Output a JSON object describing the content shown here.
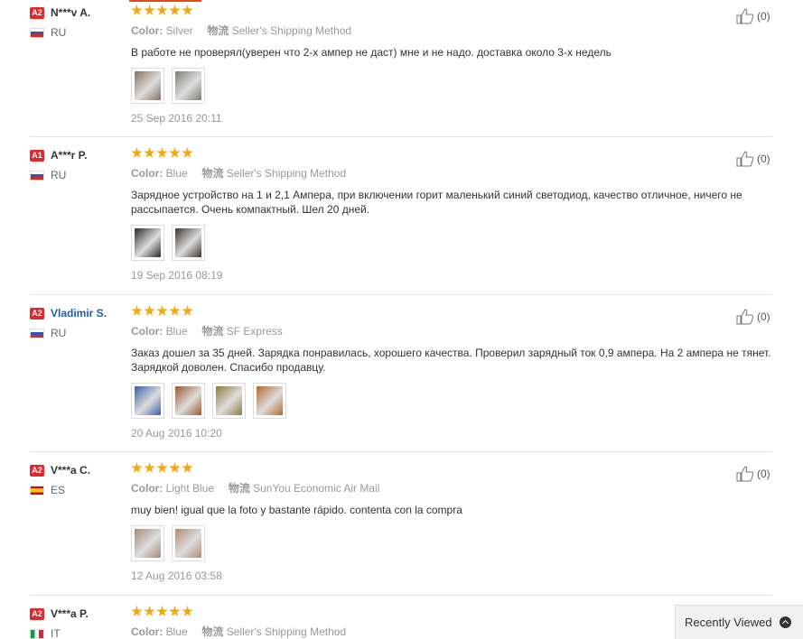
{
  "feedback": [
    {
      "level": "A2",
      "name": "N***v A.",
      "name_link": false,
      "country": "RU",
      "flag": "ru",
      "rating": 5,
      "color_label": "Color:",
      "color_value": "Silver",
      "ship_label": "物流",
      "ship_value": "Seller's Shipping Method",
      "text": "В работе не проверял(уверен что 2-х ампер не даст) мне и не надо. доставка около 3-х недель",
      "thumbs": [
        "#8a6f5e",
        "#7d7d78"
      ],
      "date": "25 Sep 2016 20:11",
      "helpful": "(0)"
    },
    {
      "level": "A1",
      "name": "A***r P.",
      "name_link": false,
      "country": "RU",
      "flag": "ru",
      "rating": 5,
      "color_label": "Color:",
      "color_value": "Blue",
      "ship_label": "物流",
      "ship_value": "Seller's Shipping Method",
      "text": "Зарядное устройство на 1 и 2,1 Ампера, при включении горит маленький синий светодиод, качество отличное, ничего не рассыпается. Очень компактный. Шел 20 дней.",
      "thumbs": [
        "#2a2a2a",
        "#3a3330"
      ],
      "date": "19 Sep 2016 08:19",
      "helpful": "(0)"
    },
    {
      "level": "A2",
      "name": "Vladimir S.",
      "name_link": true,
      "country": "RU",
      "flag": "ru",
      "rating": 5,
      "color_label": "Color:",
      "color_value": "Blue",
      "ship_label": "物流",
      "ship_value": "SF Express",
      "text": "Заказ дошел за 35 дней. Зарядка понравилась, хорошего качества. Проверил зарядный ток 0,9 ампера. На 2 ампера не тянет. Зарядкой доволен. Спасибо продавцу.",
      "thumbs": [
        "#3b5fa8",
        "#9a5a2e",
        "#8f7a3a",
        "#b3692e"
      ],
      "date": "20 Aug 2016 10:20",
      "helpful": "(0)"
    },
    {
      "level": "A2",
      "name": "V***a C.",
      "name_link": false,
      "country": "ES",
      "flag": "es",
      "rating": 5,
      "color_label": "Color:",
      "color_value": "Light Blue",
      "ship_label": "物流",
      "ship_value": "SunYou Economic Air Mail",
      "text": "muy bien! igual que la foto y bastante rápido. contenta con la compra",
      "thumbs": [
        "#a88a76",
        "#b28a70"
      ],
      "date": "12 Aug 2016 03:58",
      "helpful": "(0)"
    },
    {
      "level": "A2",
      "name": "V***a P.",
      "name_link": false,
      "country": "IT",
      "flag": "it",
      "rating": 5,
      "color_label": "Color:",
      "color_value": "Blue",
      "ship_label": "物流",
      "ship_value": "Seller's Shipping Method",
      "text": "",
      "thumbs": [],
      "date": "",
      "helpful": ""
    }
  ],
  "recently_viewed": "Recently Viewed",
  "colors": {
    "accent": "#e8490f",
    "level_badge": "#e0292b",
    "star": "#f6a709",
    "link": "#1a5fb4"
  }
}
